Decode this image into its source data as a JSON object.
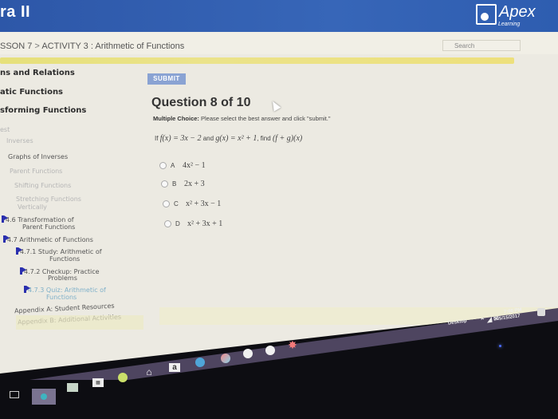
{
  "header": {
    "course_title": "ra II",
    "logo": {
      "name": "Apex",
      "sub": "Learning"
    }
  },
  "breadcrumb": {
    "lesson": "SSON 7",
    "separator": ">",
    "activity": "ACTIVITY 3",
    "activity_title": ": Arithmetic of Functions"
  },
  "search": {
    "placeholder": "Search"
  },
  "sidebar": {
    "items": [
      {
        "label": "ns and Relations",
        "style": "head"
      },
      {
        "label": "atic Functions",
        "style": "head"
      },
      {
        "label": "sforming Functions",
        "style": "head"
      },
      {
        "label": "est",
        "style": "faint"
      },
      {
        "label": "Inverses",
        "style": "faint"
      },
      {
        "label": "Graphs of Inverses",
        "style": "sub"
      },
      {
        "label": "Parent Functions",
        "style": "faint"
      },
      {
        "label": "Shifting Functions",
        "style": "faint"
      },
      {
        "label": "Stretching Functions",
        "style": "faint"
      },
      {
        "label": "Vertically",
        "style": "faint"
      },
      {
        "label": "4.6  Transformation of",
        "style": "sub"
      },
      {
        "label": "Parent Functions",
        "style": "sub"
      },
      {
        "label": "4.7  Arithmetic of Functions",
        "style": "sub"
      },
      {
        "label": "4.7.1 Study: Arithmetic of",
        "style": "sub"
      },
      {
        "label": "Functions",
        "style": "sub"
      },
      {
        "label": "4.7.2 Checkup: Practice",
        "style": "sub"
      },
      {
        "label": "Problems",
        "style": "sub"
      },
      {
        "label": "4.7.3 Quiz: Arithmetic of",
        "style": "link"
      },
      {
        "label": "Functions",
        "style": "link"
      },
      {
        "label": "Appendix A: Student Resources",
        "style": "sub"
      },
      {
        "label": "Appendix B: Additional Activities",
        "style": "sub"
      }
    ]
  },
  "question": {
    "submit_label": "SUBMIT",
    "title": "Question 8 of 10",
    "instruction_bold": "Multiple Choice:",
    "instruction": " Please select the best answer and click \"submit.\"",
    "prompt_if": "If",
    "prompt_f": "f(x) = 3x − 2",
    "prompt_and": "and",
    "prompt_g": "g(x) = x² + 1",
    "prompt_find": ", find",
    "prompt_target": "(f + g)(x)",
    "options": [
      {
        "letter": "A",
        "text": "4x² − 1"
      },
      {
        "letter": "B",
        "text": "2x + 3"
      },
      {
        "letter": "C",
        "text": "x² + 3x − 1"
      },
      {
        "letter": "D",
        "text": "x² + 3x + 1"
      }
    ]
  },
  "taskbar": {
    "desktop_label": "Desktop",
    "time": "7:06 PM",
    "date": "5/15/2017",
    "icons": [
      "task-view",
      "cortana",
      "mail",
      "store",
      "spotify",
      "home",
      "amazon",
      "chrome-like",
      "browser",
      "app-circle",
      "app-circle-2",
      "star-app"
    ]
  }
}
